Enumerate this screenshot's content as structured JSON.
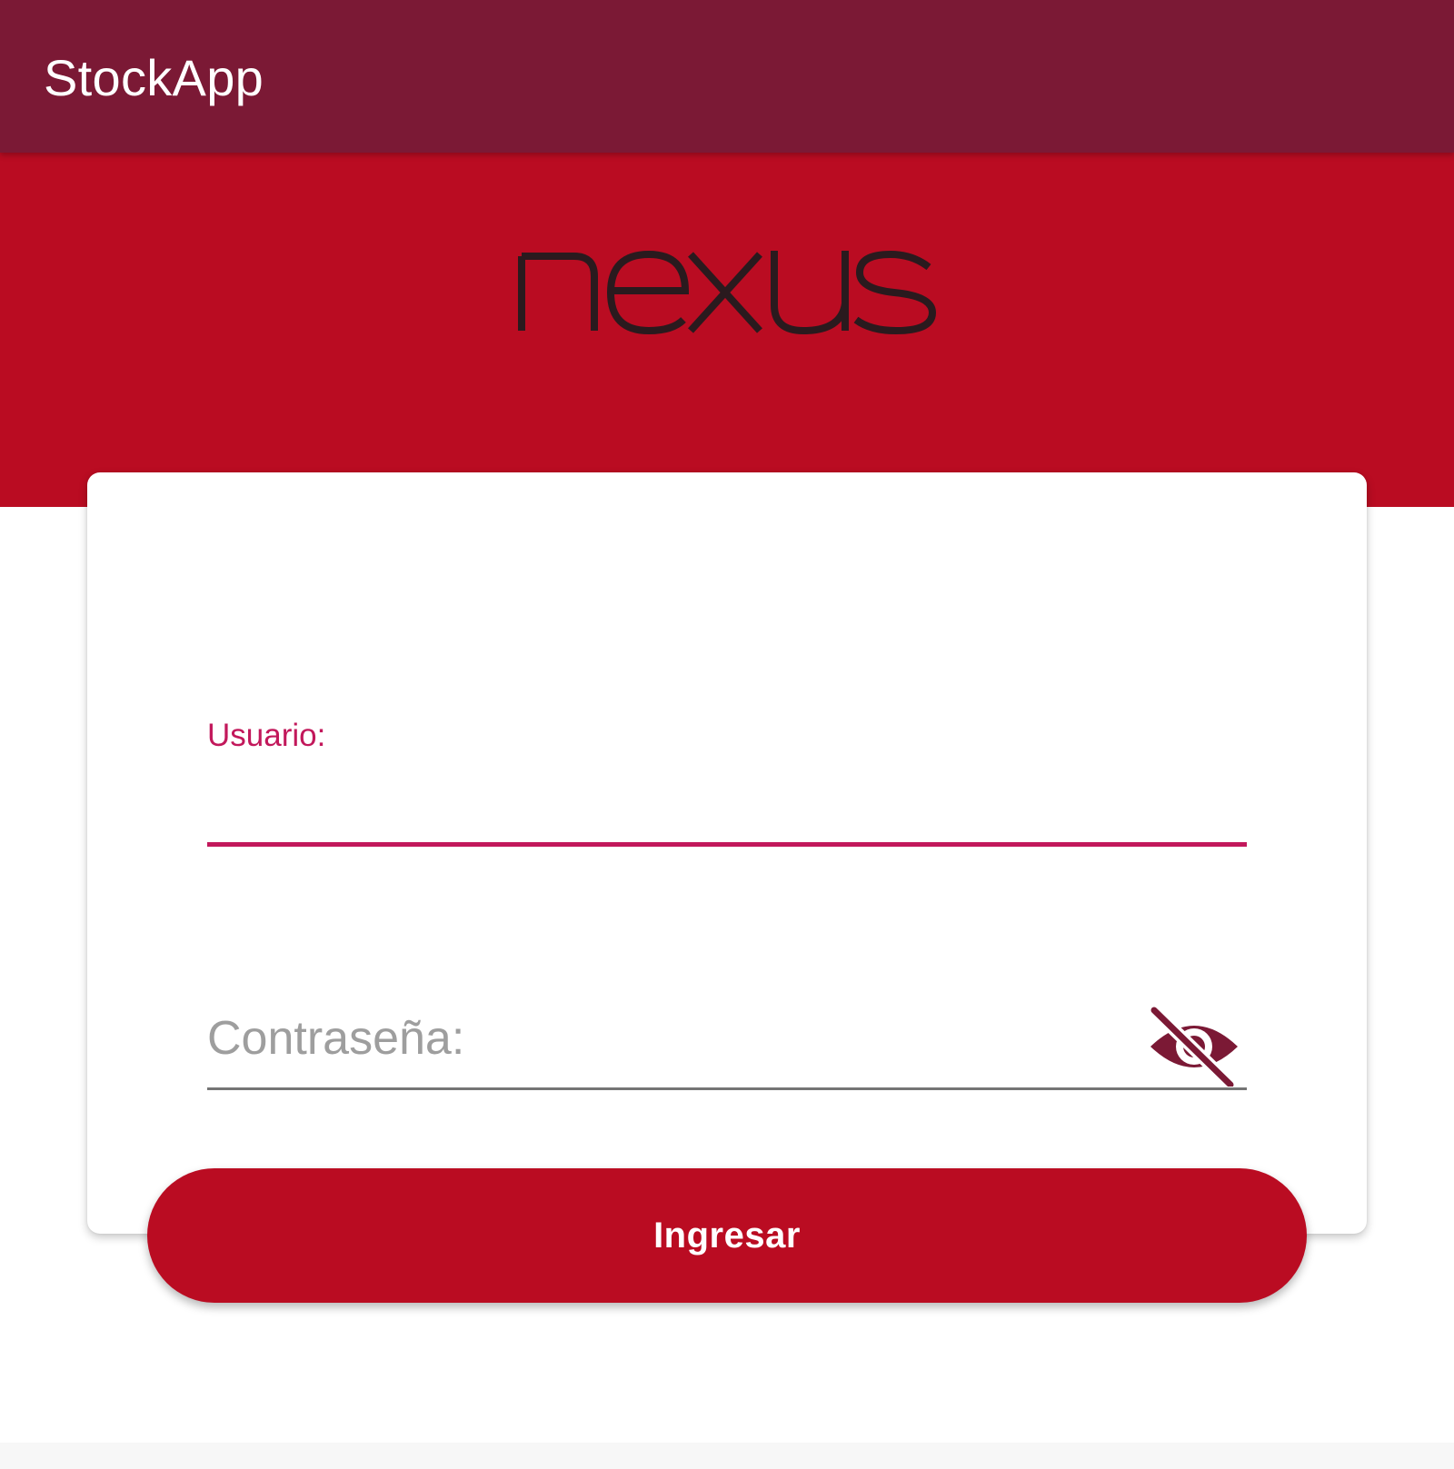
{
  "app_bar": {
    "title": "StockApp"
  },
  "hero": {
    "logo_text": "nexus",
    "logo_icon": "nexus-wordmark-logo"
  },
  "login_form": {
    "user_label": "Usuario:",
    "user_value": "",
    "password_placeholder": "Contraseña:",
    "password_value": "",
    "visibility_icon": "eye-off-icon",
    "submit_label": "Ingresar"
  },
  "colors": {
    "app_bar": "#7b1935",
    "hero": "#ba0c22",
    "accent": "#c2185b",
    "button": "#ba0c22",
    "icon": "#7b1935"
  }
}
